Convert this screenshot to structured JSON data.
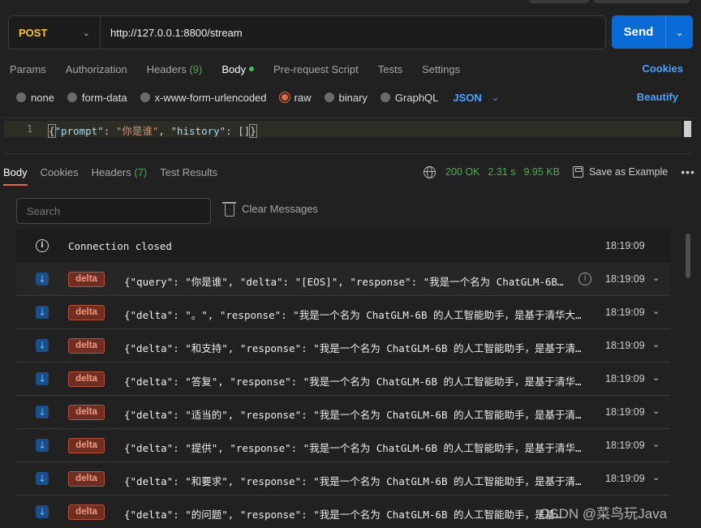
{
  "request": {
    "method": "POST",
    "url": "http://127.0.0.1:8800/stream",
    "send_label": "Send"
  },
  "req_tabs": {
    "params": "Params",
    "authorization": "Authorization",
    "headers": "Headers",
    "headers_count": "(9)",
    "body": "Body",
    "prerequest": "Pre-request Script",
    "tests": "Tests",
    "settings": "Settings",
    "cookies": "Cookies"
  },
  "body_types": {
    "none": "none",
    "form_data": "form-data",
    "urlencoded": "x-www-form-urlencoded",
    "raw": "raw",
    "binary": "binary",
    "graphql": "GraphQL",
    "format": "JSON",
    "beautify": "Beautify",
    "selected": "raw"
  },
  "editor": {
    "line_number": "1",
    "tokens": {
      "open": "{",
      "key1": "\"prompt\"",
      "colon1": ": ",
      "val1": "\"你是谁\"",
      "comma": ", ",
      "key2": "\"history\"",
      "colon2": ": ",
      "val2": "[]",
      "close": "}"
    }
  },
  "resp_tabs": {
    "body": "Body",
    "cookies": "Cookies",
    "headers": "Headers",
    "headers_count": "(7)",
    "test_results": "Test Results"
  },
  "resp_meta": {
    "status": "200 OK",
    "time": "2.31 s",
    "size": "9.95 KB",
    "save": "Save as Example",
    "more": "•••"
  },
  "toolbar": {
    "search_placeholder": "Search",
    "clear": "Clear Messages"
  },
  "messages": {
    "connection": {
      "text": "Connection closed",
      "time": "18:19:09"
    },
    "items": [
      {
        "badge": "delta",
        "text": "{\"query\": \"你是谁\", \"delta\": \"[EOS]\", \"response\": \"我是一个名为 ChatGLM-6B …",
        "time": "18:19:09"
      },
      {
        "badge": "delta",
        "text": "{\"delta\": \"。\", \"response\": \"我是一个名为 ChatGLM-6B 的人工智能助手，是基于清华大学 K…",
        "time": "18:19:09"
      },
      {
        "badge": "delta",
        "text": "{\"delta\": \"和支持\", \"response\": \"我是一个名为 ChatGLM-6B 的人工智能助手，是基于清华大…",
        "time": "18:19:09"
      },
      {
        "badge": "delta",
        "text": "{\"delta\": \"答复\", \"response\": \"我是一个名为 ChatGLM-6B 的人工智能助手，是基于清华大学…",
        "time": "18:19:09"
      },
      {
        "badge": "delta",
        "text": "{\"delta\": \"适当的\", \"response\": \"我是一个名为 ChatGLM-6B 的人工智能助手，是基于清华大…",
        "time": "18:19:09"
      },
      {
        "badge": "delta",
        "text": "{\"delta\": \"提供\", \"response\": \"我是一个名为 ChatGLM-6B 的人工智能助手，是基于清华大学…",
        "time": "18:19:09"
      },
      {
        "badge": "delta",
        "text": "{\"delta\": \"和要求\", \"response\": \"我是一个名为 ChatGLM-6B 的人工智能助手，是基于清华大…",
        "time": "18:19:09"
      },
      {
        "badge": "delta",
        "text": "{\"delta\": \"的问题\", \"response\": \"我是一个名为 ChatGLM-6B 的人工智能助手，是基于清华…",
        "time": ""
      }
    ]
  },
  "watermark": "CSDN @菜鸟玩Java",
  "colors": {
    "accent": "#0b6bd6",
    "method": "#f5c33b",
    "success": "#4caf50",
    "badge": "#b8503a",
    "link": "#4aa3ff"
  }
}
